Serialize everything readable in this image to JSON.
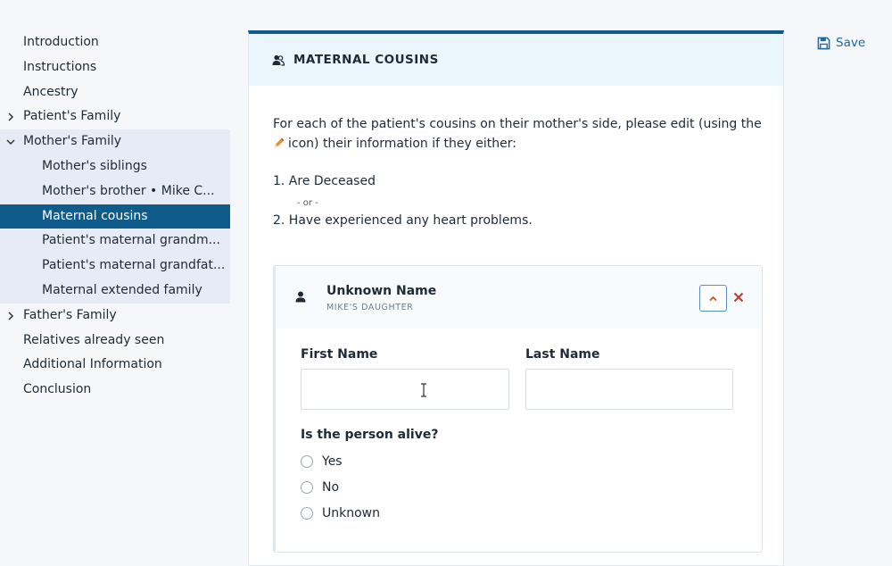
{
  "sidebar": {
    "items": [
      {
        "label": "Introduction"
      },
      {
        "label": "Instructions"
      },
      {
        "label": "Ancestry"
      },
      {
        "label": "Patient's Family"
      },
      {
        "label": "Mother's Family"
      },
      {
        "label": "Father's Family"
      },
      {
        "label": "Relatives already seen"
      },
      {
        "label": "Additional Information"
      },
      {
        "label": "Conclusion"
      }
    ],
    "mothers_children": [
      {
        "label": "Mother's siblings"
      },
      {
        "label": "Mother's brother • Mike C..."
      },
      {
        "label": "Maternal cousins"
      },
      {
        "label": "Patient's maternal grandm..."
      },
      {
        "label": "Patient's maternal grandfat..."
      },
      {
        "label": "Maternal extended family"
      }
    ]
  },
  "toolbar": {
    "save_label": "Save"
  },
  "section": {
    "title": "MATERNAL COUSINS",
    "intro_part1": "For each of the patient's cousins on their mother's side, please edit (using the",
    "intro_part2": "icon) their information if they either:",
    "item1": "1. Are Deceased",
    "or_text": "- or -",
    "item2": "2. Have experienced any heart problems."
  },
  "person": {
    "name": "Unknown Name",
    "relation": "MIKE'S DAUGHTER",
    "first_name_label": "First Name",
    "last_name_label": "Last Name",
    "first_name_value": "",
    "last_name_value": "",
    "alive_question": "Is the person alive?",
    "alive_options": [
      "Yes",
      "No",
      "Unknown"
    ]
  },
  "colors": {
    "primary": "#0e5b8c",
    "link": "#1a6ba3",
    "header_bg": "#e9f7fd",
    "danger": "#c0392b",
    "pencil": "#d9822b"
  },
  "icons": {
    "save": "floppy-disk-icon",
    "section": "users-icon",
    "person": "user-icon",
    "edit": "pencil-icon",
    "collapse": "chevron-up-icon",
    "remove": "close-icon"
  }
}
